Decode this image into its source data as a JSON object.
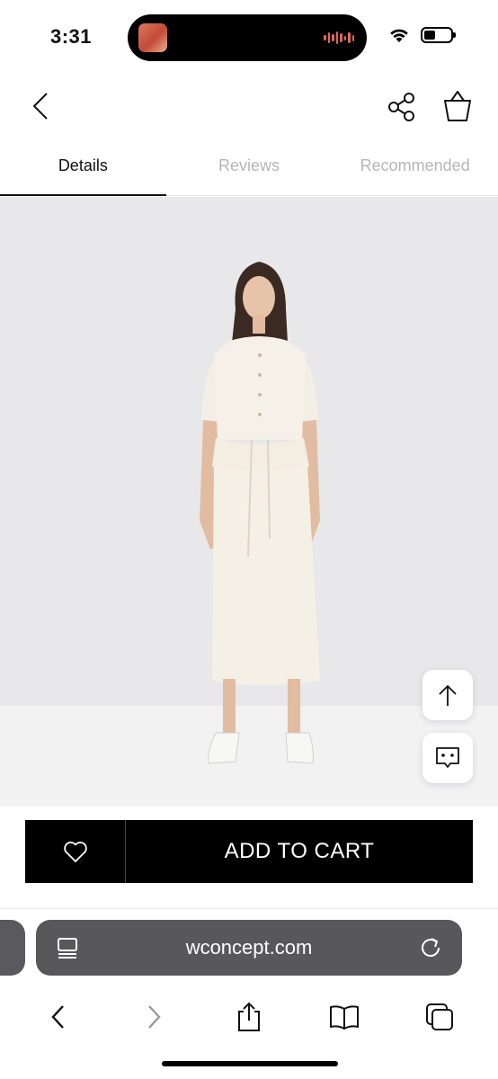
{
  "status": {
    "time": "3:31"
  },
  "tabs": [
    {
      "label": "Details"
    },
    {
      "label": "Reviews"
    },
    {
      "label": "Recommended"
    }
  ],
  "product": {
    "image_name": "model-white-dress"
  },
  "actions": {
    "add_to_cart_label": "ADD TO CART"
  },
  "browser": {
    "url": "wconcept.com"
  },
  "colors": {
    "accent": "#000000",
    "inactive_tab": "#b6b6b6",
    "address_bar": "#58585a"
  }
}
